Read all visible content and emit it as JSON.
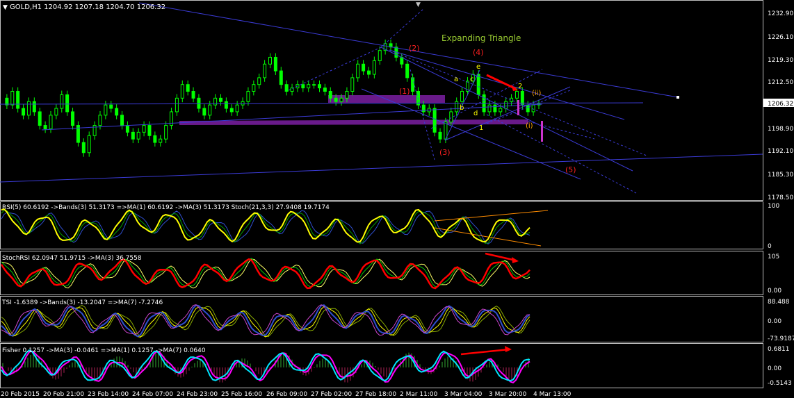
{
  "colors": {
    "background": "#000000",
    "bull_candle": "#00ff00",
    "bear_candle": "#00ff00",
    "trendline": "#3b3bd6",
    "channel_fill": "#7b1fa2",
    "label_red": "#ff2020",
    "label_yellow": "#ffff00",
    "label_orange": "#ffa500",
    "label_green": "#8fbc3f",
    "axis_text": "#ffffff",
    "separator": "#c0c0c0"
  },
  "main": {
    "header": "GOLD,H1  1204.92 1207.18 1204.70 1206.32",
    "pattern_title": "Expanding Triangle",
    "current_price": "1206.32",
    "price_ticks": [
      "1232.90",
      "1226.10",
      "1219.30",
      "1212.50",
      "1206.32",
      "1198.90",
      "1192.10",
      "1185.30",
      "1178.50"
    ],
    "wave_labels_red": [
      "(1)",
      "(2)",
      "(3)",
      "(4)",
      "(5)"
    ],
    "wave_labels_yellow": [
      "a",
      "b",
      "c",
      "d",
      "e",
      "1",
      "2"
    ],
    "wave_labels_orange": [
      "(i)",
      "(ii)"
    ]
  },
  "chart_data": {
    "type": "candlestick",
    "symbol": "GOLD",
    "timeframe": "H1",
    "ohlc_last": {
      "open": 1204.92,
      "high": 1207.18,
      "low": 1204.7,
      "close": 1206.32
    },
    "ylim": [
      1178.5,
      1236.0
    ],
    "x_ticks": [
      "20 Feb 2015",
      "20 Feb 21:00",
      "23 Feb 14:00",
      "24 Feb 07:00",
      "24 Feb 23:00",
      "25 Feb 16:00",
      "26 Feb 09:00",
      "27 Feb 02:00",
      "27 Feb 18:00",
      "2 Mar 11:00",
      "3 Mar 04:00",
      "3 Mar 20:00",
      "4 Mar 13:00"
    ],
    "close_series": [
      1208,
      1206,
      1210,
      1205,
      1203,
      1207,
      1204,
      1200,
      1199,
      1203,
      1205,
      1209,
      1204,
      1200,
      1195,
      1192,
      1197,
      1200,
      1203,
      1206,
      1205,
      1203,
      1200,
      1198,
      1196,
      1198,
      1200,
      1197,
      1195,
      1196,
      1200,
      1204,
      1208,
      1212,
      1210,
      1208,
      1205,
      1203,
      1206,
      1208,
      1207,
      1205,
      1204,
      1206,
      1207,
      1210,
      1212,
      1214,
      1218,
      1220,
      1216,
      1212,
      1210,
      1211,
      1212,
      1211,
      1212,
      1212,
      1211,
      1210,
      1208,
      1207,
      1208,
      1210,
      1214,
      1218,
      1216,
      1215,
      1219,
      1222,
      1224,
      1223,
      1220,
      1218,
      1214,
      1210,
      1206,
      1204,
      1205,
      1198,
      1196,
      1201,
      1204,
      1207,
      1210,
      1213,
      1215,
      1209,
      1204,
      1206,
      1204,
      1205,
      1207,
      1208,
      1210,
      1206,
      1204,
      1206,
      1206.32
    ],
    "indicators": [
      {
        "name": "RSI(5)",
        "header": "RSI(5) 60.6192  ->Bands(3) 51.3173  =>MA(1) 60.6192  ->MA(3) 51.3173  Stoch(21,3,3) 27.9408 19.7174",
        "ticks": [
          "100",
          "0"
        ]
      },
      {
        "name": "StochRSI",
        "header": "StochRSI 62.0947 51.9715  ->MA(3) 36.7558",
        "ticks": [
          "105",
          "0.00"
        ]
      },
      {
        "name": "TSI",
        "header": "TSI -1.6389  ->Bands(3) -13.2047  =>MA(7) -7.2746",
        "ticks": [
          "88.488",
          "0.00",
          "-73.9187"
        ]
      },
      {
        "name": "Fisher",
        "header": "Fisher 0.1257  ->MA(3) -0.0461  =>MA(1) 0.1257  ->MA(7) 0.0640",
        "ticks": [
          "0.6811",
          "0.00",
          "-0.5143"
        ]
      }
    ]
  }
}
